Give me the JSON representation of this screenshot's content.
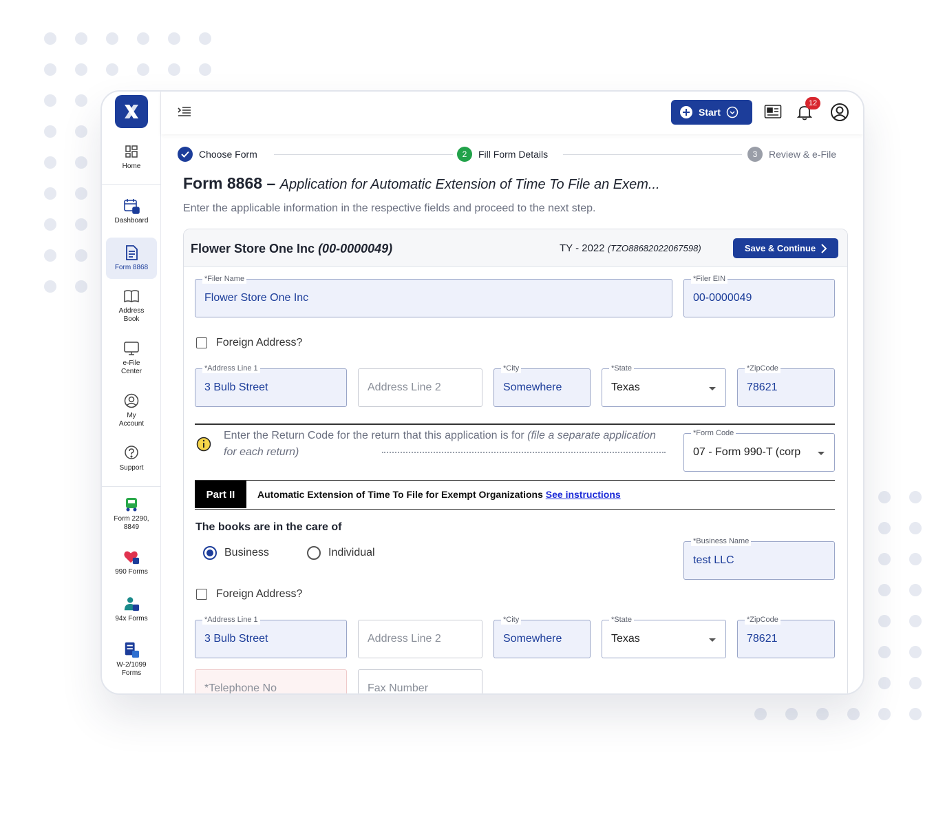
{
  "sidebar": {
    "items": [
      {
        "label_1": "Home",
        "label_2": ""
      },
      {
        "label_1": "Dashboard",
        "label_2": ""
      },
      {
        "label_1": "Form 8868",
        "label_2": ""
      },
      {
        "label_1": "Address",
        "label_2": "Book"
      },
      {
        "label_1": "e-File",
        "label_2": "Center"
      },
      {
        "label_1": "My",
        "label_2": "Account"
      },
      {
        "label_1": "Support",
        "label_2": ""
      },
      {
        "label_1": "Form 2290,",
        "label_2": "8849"
      },
      {
        "label_1": "990 Forms",
        "label_2": ""
      },
      {
        "label_1": "94x Forms",
        "label_2": ""
      },
      {
        "label_1": "W-2/1099",
        "label_2": "Forms"
      }
    ]
  },
  "header": {
    "start_label": "Start",
    "notification_count": "12"
  },
  "stepper": {
    "steps": [
      {
        "num": "",
        "label": "Choose Form"
      },
      {
        "num": "2",
        "label": "Fill Form Details"
      },
      {
        "num": "3",
        "label": "Review & e-File"
      }
    ]
  },
  "page": {
    "title_form": "Form 8868 –",
    "title_desc": "Application for Automatic Extension of Time To File an Exem...",
    "subtitle": "Enter the applicable information in the respective fields and proceed to the next step."
  },
  "card": {
    "org_name": "Flower Store One Inc",
    "org_ein": "(00-0000049)",
    "ty_label": "TY - 2022",
    "ty_code": "(TZO88682022067598)",
    "save_label": "Save & Continue"
  },
  "filer": {
    "name_label": "*Filer Name",
    "name_value": "Flower Store One Inc",
    "ein_label": "*Filer EIN",
    "ein_value": "00-0000049",
    "foreign_label": "Foreign Address?",
    "addr1_label": "*Address Line 1",
    "addr1_value": "3 Bulb Street",
    "addr2_placeholder": "Address Line 2",
    "city_label": "*City",
    "city_value": "Somewhere",
    "state_label": "*State",
    "state_value": "Texas",
    "zip_label": "*ZipCode",
    "zip_value": "78621"
  },
  "return_code": {
    "text_plain": "Enter the Return Code for the return that this application is for ",
    "text_italic": "(file a separate application for each return)",
    "form_code_label": "*Form Code",
    "form_code_value": "07 - Form 990-T (corp"
  },
  "part2": {
    "tag": "Part II",
    "title": "Automatic Extension of Time To File for Exempt Organizations",
    "link": "See instructions"
  },
  "books": {
    "heading": "The books are in the care of",
    "option_business": "Business",
    "option_individual": "Individual",
    "selected": "Business",
    "business_name_label": "*Business Name",
    "business_name_value": "test LLC",
    "foreign_label": "Foreign Address?",
    "addr1_label": "*Address Line 1",
    "addr1_value": "3 Bulb Street",
    "addr2_placeholder": "Address Line 2",
    "city_label": "*City",
    "city_value": "Somewhere",
    "state_label": "*State",
    "state_value": "Texas",
    "zip_label": "*ZipCode",
    "zip_value": "78621",
    "telephone_placeholder": "*Telephone No",
    "fax_placeholder": "Fax Number"
  },
  "colors": {
    "primary": "#1c3d9a",
    "success": "#22a24a",
    "badge": "#d8262e",
    "field_fill": "#eef1fb"
  }
}
